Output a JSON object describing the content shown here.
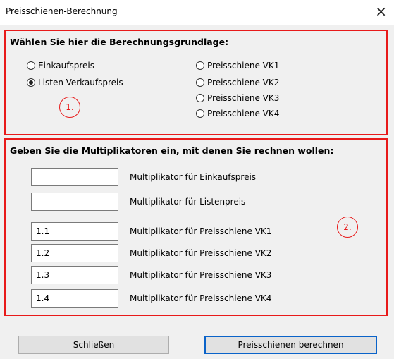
{
  "window": {
    "title": "Preisschienen-Berechnung",
    "close_glyph": "×"
  },
  "group1": {
    "heading": "Wählen Sie hier die Berechnungsgrundlage:",
    "badge": "1.",
    "radios_left": [
      {
        "label": "Einkaufspreis",
        "checked": false
      },
      {
        "label": "Listen-Verkaufspreis",
        "checked": true
      }
    ],
    "radios_right": [
      {
        "label": "Preisschiene VK1",
        "checked": false
      },
      {
        "label": "Preisschiene VK2",
        "checked": false
      },
      {
        "label": "Preisschiene VK3",
        "checked": false
      },
      {
        "label": "Preisschiene VK4",
        "checked": false
      }
    ]
  },
  "group2": {
    "heading": "Geben Sie die Multiplikatoren ein, mit denen Sie rechnen wollen:",
    "badge": "2.",
    "rows": [
      {
        "value": "",
        "label": "Multiplikator für Einkaufspreis"
      },
      {
        "value": "",
        "label": "Multiplikator für Listenpreis"
      },
      {
        "value": "1.1",
        "label": "Multiplikator für Preisschiene VK1"
      },
      {
        "value": "1.2",
        "label": "Multiplikator für Preisschiene VK2"
      },
      {
        "value": "1.3",
        "label": "Multiplikator für Preisschiene VK3"
      },
      {
        "value": "1.4",
        "label": "Multiplikator für Preisschiene VK4"
      }
    ]
  },
  "buttons": {
    "close_label": "Schließen",
    "calculate_label": "Preisschienen berechnen"
  },
  "colors": {
    "annotation_red": "#e81a1a",
    "default_button_border": "#0a63c9",
    "dialog_background": "#f0f0f0"
  }
}
